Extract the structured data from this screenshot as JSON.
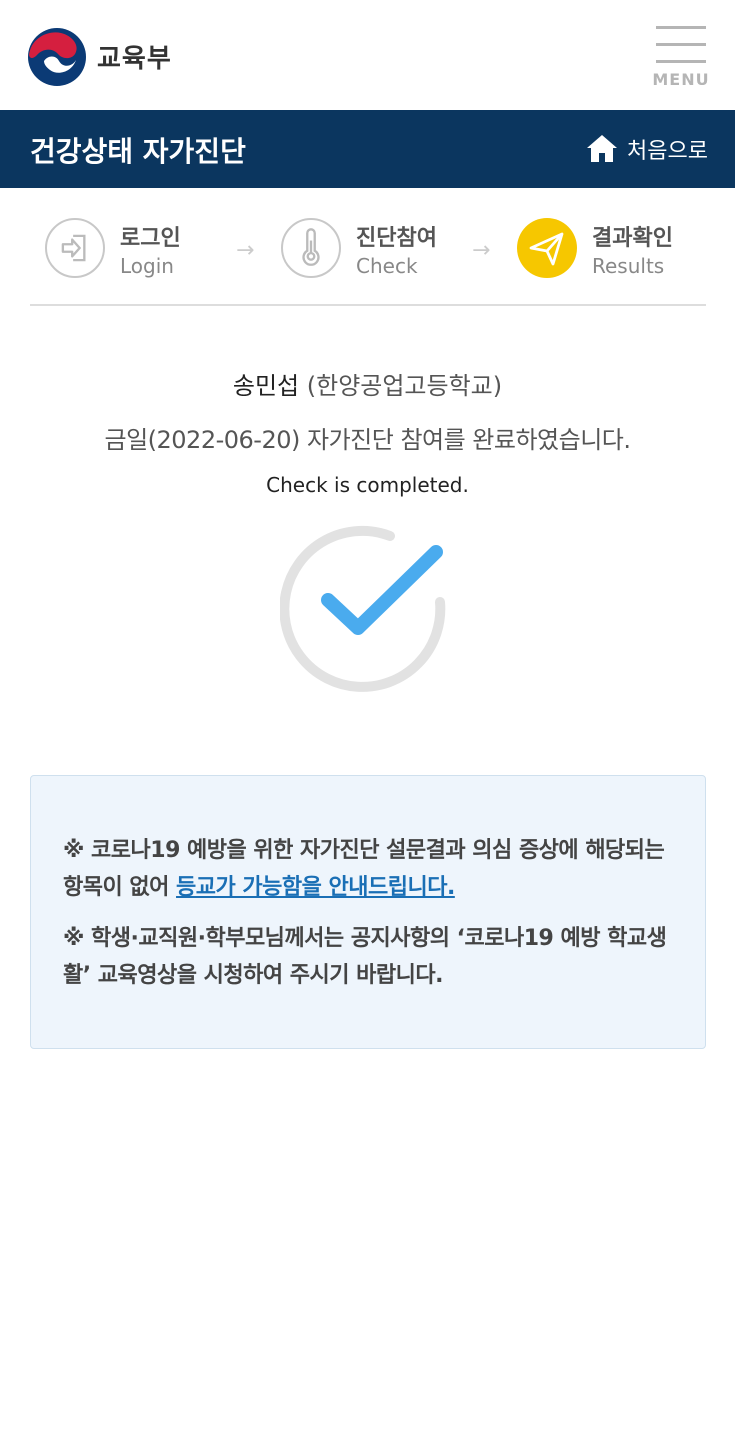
{
  "header": {
    "ministry_name": "교육부",
    "menu_label": "MENU"
  },
  "titlebar": {
    "title": "건강상태 자가진단",
    "home_label": "처음으로"
  },
  "steps": [
    {
      "label_ko": "로그인",
      "label_en": "Login",
      "icon": "login-icon",
      "state": "done"
    },
    {
      "label_ko": "진단참여",
      "label_en": "Check",
      "icon": "thermometer-icon",
      "state": "done"
    },
    {
      "label_ko": "결과확인",
      "label_en": "Results",
      "icon": "paper-plane-icon",
      "state": "active"
    }
  ],
  "step_arrow": "→",
  "result": {
    "student_name": "송민섭",
    "school": "(한양공업고등학교)",
    "message_ko": "금일(2022-06-20) 자가진단 참여를 완료하였습니다.",
    "message_en": "Check is completed."
  },
  "notice": {
    "line1_text": "※ 코로나19 예방을 위한 자가진단 설문결과 의심 증상에 해당되는 항목이 없어 ",
    "line1_link": "등교가 가능함을 안내드립니다.",
    "line2_text": "※ 학생·교직원·학부모님께서는 공지사항의 ‘코로나19 예방 학교생활’ 교육영상을 시청하여 주시기 바랍니다."
  },
  "colors": {
    "titlebar_bg": "#0b365f",
    "active_step": "#f6c700",
    "check_blue": "#4aabee",
    "link_blue": "#1a6fb5",
    "notice_bg": "#eef5fc"
  }
}
